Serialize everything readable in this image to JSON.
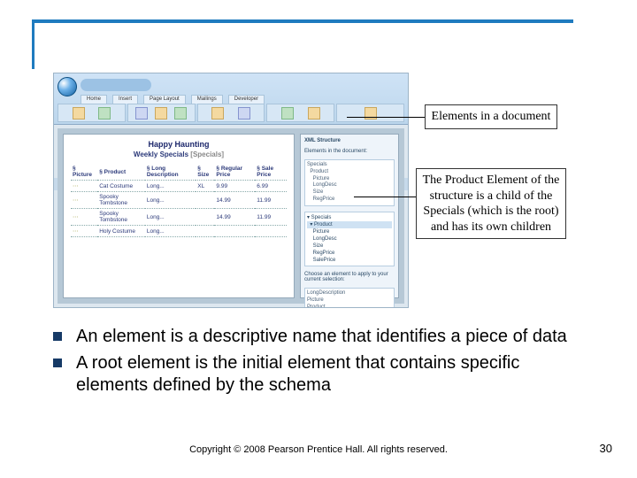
{
  "callouts": {
    "elements_in_document": "Elements in a document",
    "product_element": "The Product Element of the structure is a child of the Specials (which is the root) and has its own children"
  },
  "word_screenshot": {
    "doc_title_bold": "Happy Haunting",
    "subtitle": "Weekly Specials",
    "subtitle_bracket": "[Specials]",
    "table": {
      "headers": [
        "§ Picture",
        "§ Product",
        "§ Long Description",
        "§ Size",
        "§ Regular Price",
        "§ Sale Price"
      ],
      "rows": [
        [
          "",
          "Cat Costume",
          "Long...",
          "XL",
          "9.99",
          "6.99"
        ],
        [
          "",
          "Spooky Tombstone",
          "Long...",
          "",
          "14.99",
          "11.99"
        ],
        [
          "",
          "Spooky Tombstone",
          "Long...",
          "",
          "14.99",
          "11.99"
        ],
        [
          "",
          "Holy Costume",
          "Long...",
          "",
          "",
          ""
        ]
      ]
    },
    "taskpane": {
      "title": "XML Structure",
      "hint_label": "Elements in the document:",
      "hint_box": "Specials\n  Product\n    Picture\n    LongDesc\n    Size\n    RegPrice",
      "tree_root": "▾ Specials",
      "tree_child": "  ▾ Product",
      "tree_leaves": [
        "    Picture",
        "    LongDesc",
        "    Size",
        "    RegPrice",
        "    SalePrice"
      ],
      "apply_label": "Choose an element to apply to your current selection:",
      "apply_box": "LongDescription\nPicture\nProduct\nRegularPrice\nSalePrice\nSize\nSpecials"
    }
  },
  "bullets": [
    "An element is a descriptive name that identifies a piece of data",
    "A root element is the initial element that contains specific elements defined by the schema"
  ],
  "footer": {
    "copyright": "Copyright © 2008 Pearson Prentice Hall. All rights reserved.",
    "page": "30"
  }
}
